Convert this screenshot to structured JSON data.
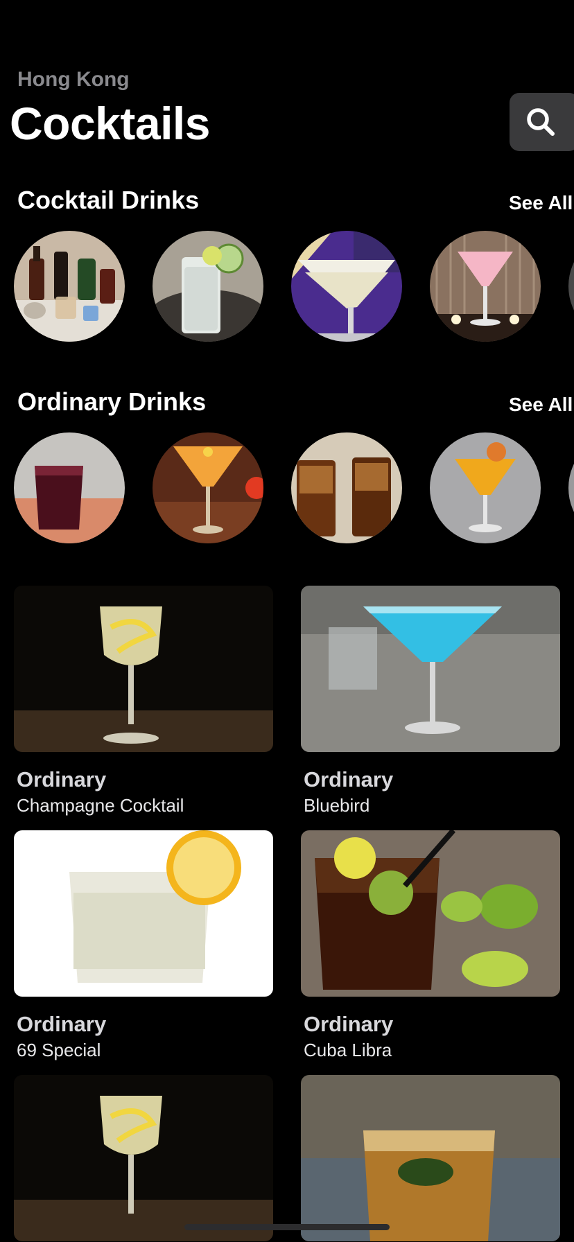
{
  "header": {
    "location": "Hong Kong",
    "title": "Cocktails",
    "search_icon": "search-icon"
  },
  "sections": [
    {
      "title": "Cocktail Drinks",
      "see_all": "See All"
    },
    {
      "title": "Ordinary Drinks",
      "see_all": "See All"
    }
  ],
  "grid": [
    {
      "category": "Ordinary",
      "name": "Champagne Cocktail"
    },
    {
      "category": "Ordinary",
      "name": "Bluebird"
    },
    {
      "category": "Ordinary",
      "name": "69 Special"
    },
    {
      "category": "Ordinary",
      "name": "Cuba Libra"
    }
  ],
  "colors": {
    "background": "#000000",
    "secondary_text": "#8a8a8e",
    "search_button_bg": "#3a3a3c"
  }
}
